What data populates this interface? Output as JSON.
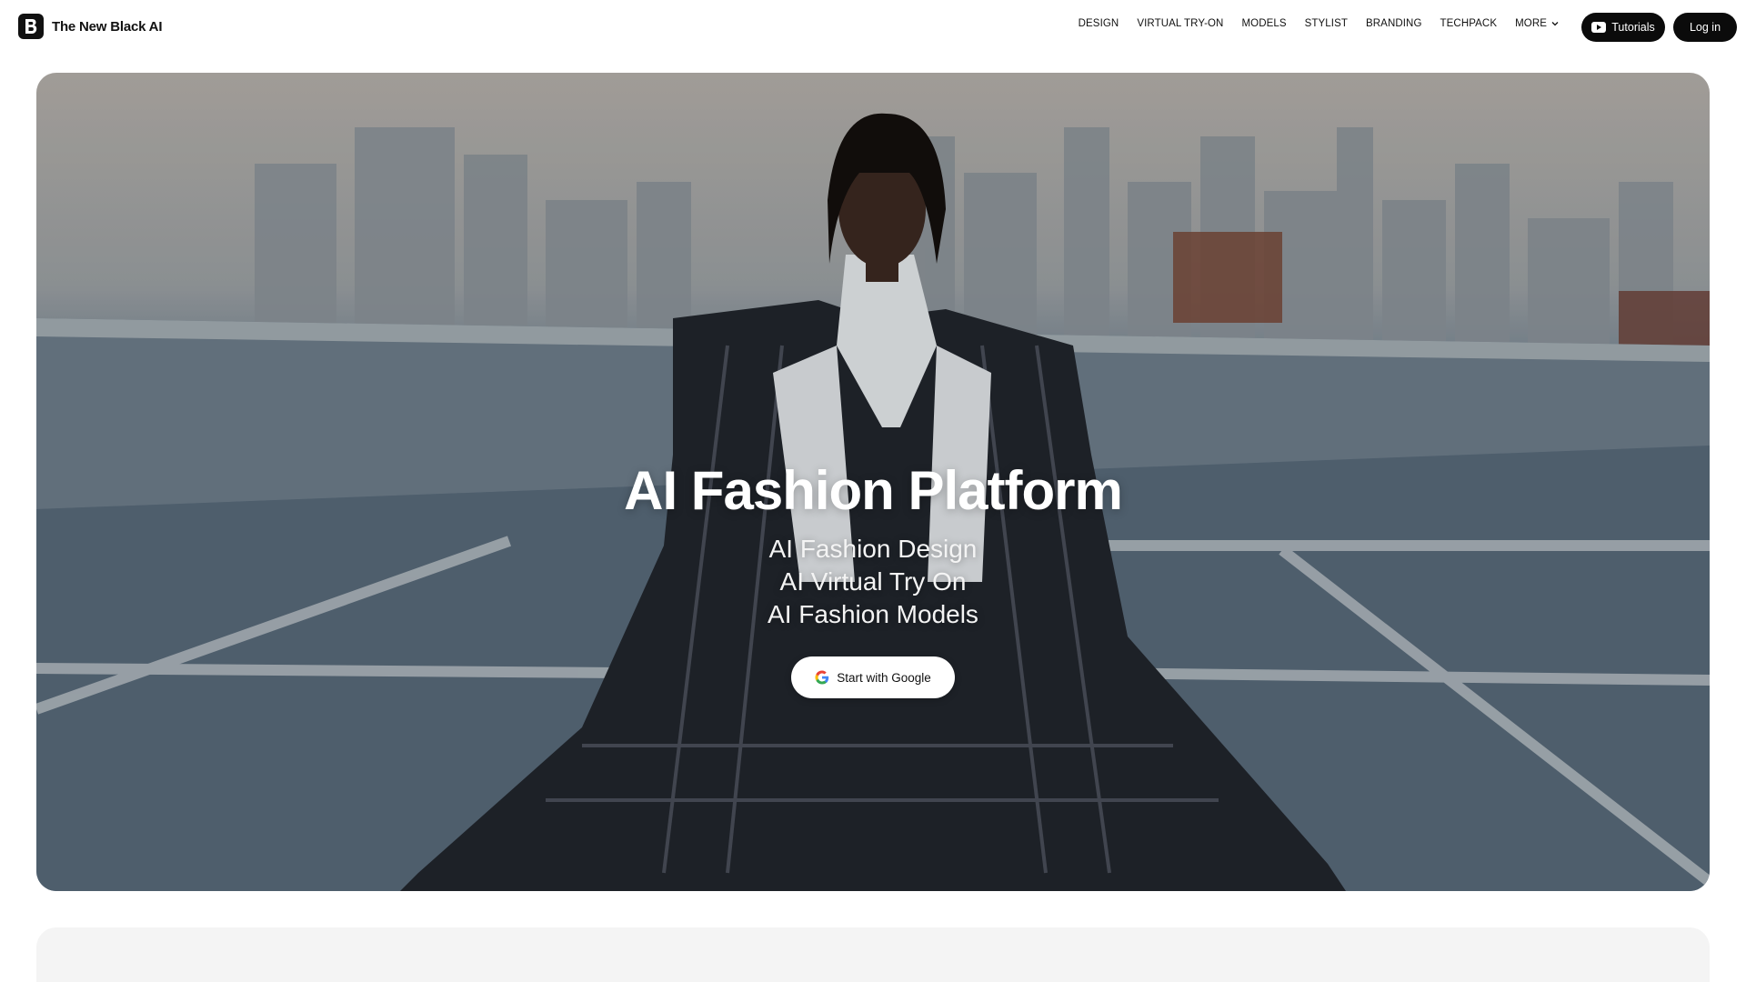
{
  "brand": {
    "name": "The New Black AI",
    "logo_icon": "b-logo-icon"
  },
  "nav": {
    "items": [
      {
        "label": "DESIGN"
      },
      {
        "label": "VIRTUAL TRY-ON"
      },
      {
        "label": "MODELS"
      },
      {
        "label": "STYLIST"
      },
      {
        "label": "BRANDING"
      },
      {
        "label": "TECHPACK"
      },
      {
        "label": "MORE",
        "icon": "chevron-down-icon"
      }
    ],
    "tutorials_label": "Tutorials",
    "login_label": "Log in"
  },
  "hero": {
    "title": "AI Fashion Platform",
    "subtitles": [
      "AI Fashion Design",
      "AI Virtual Try On",
      "AI Fashion Models"
    ],
    "cta_label": "Start with Google",
    "cta_icon": "google-icon"
  },
  "colors": {
    "button_dark": "#0b0b0b",
    "accent_white": "#ffffff"
  }
}
